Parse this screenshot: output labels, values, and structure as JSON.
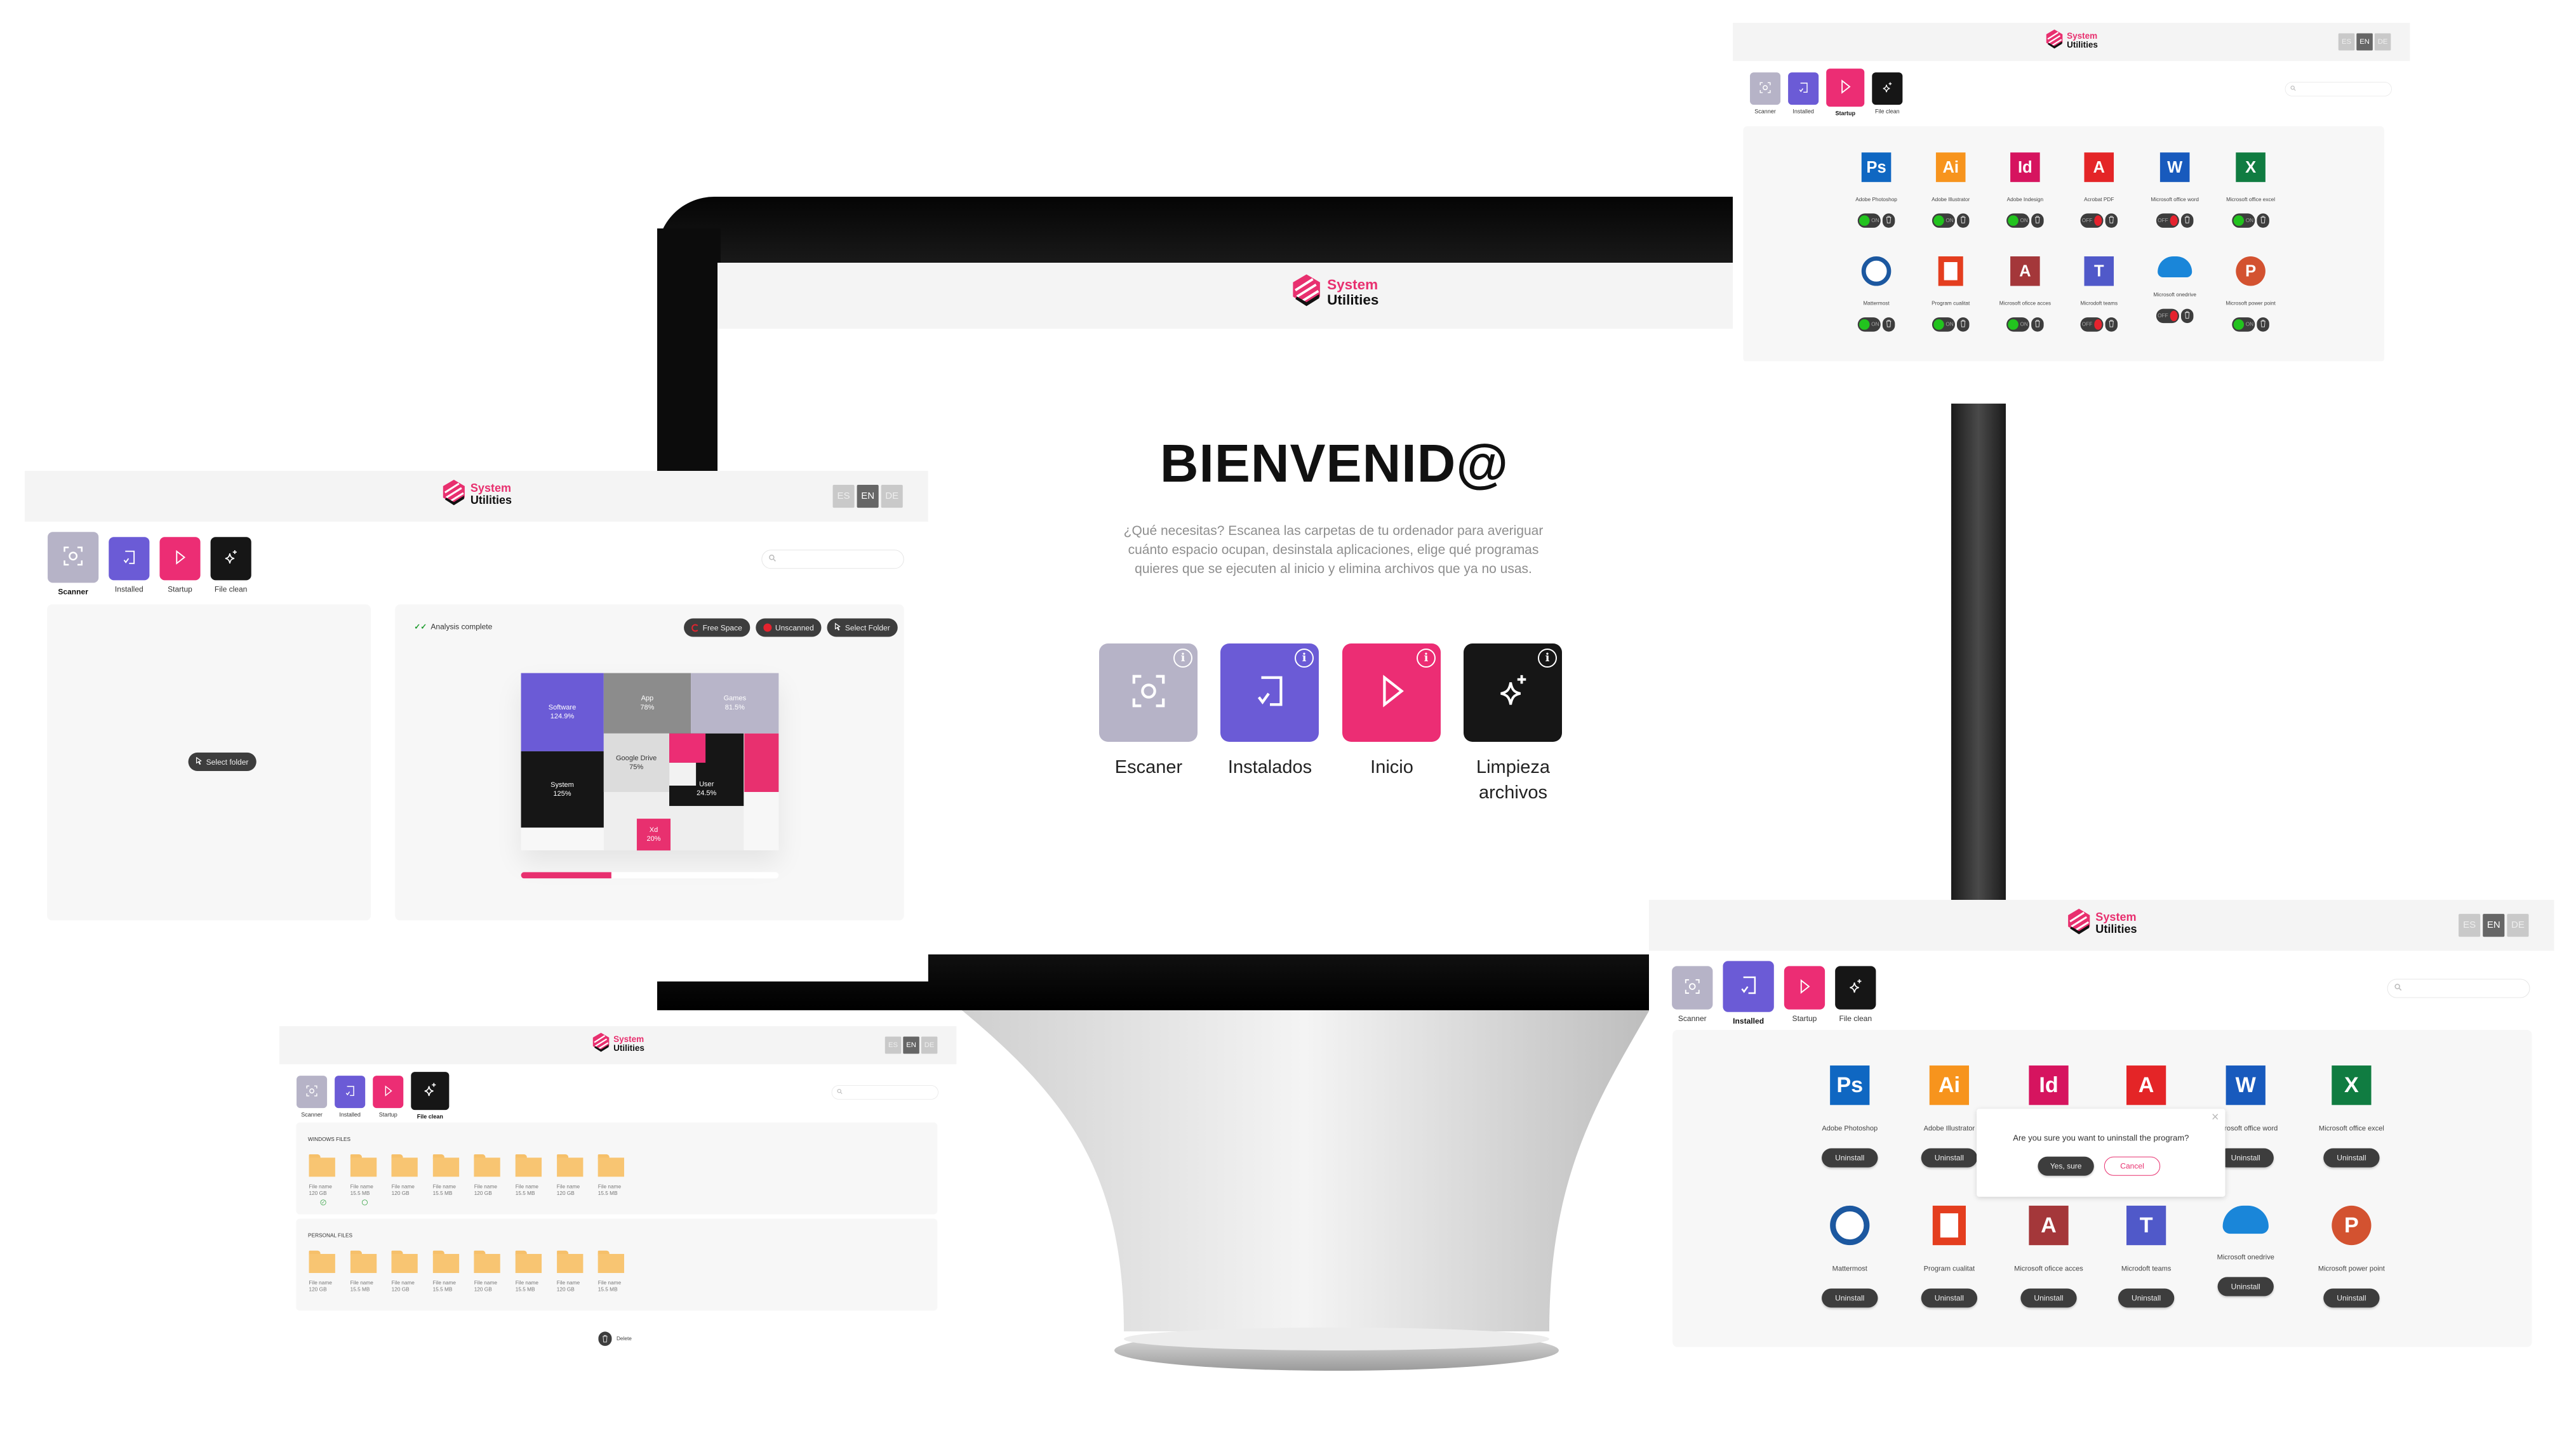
{
  "brand": {
    "line1": "System",
    "line2": "Utilities"
  },
  "languages": [
    "ES",
    "EN",
    "DE"
  ],
  "active_language": "EN",
  "nav": [
    {
      "label": "Scanner",
      "icon": "scan-icon",
      "color": "#b6b3c7"
    },
    {
      "label": "Installed",
      "icon": "installed-icon",
      "color": "#6b5bd6"
    },
    {
      "label": "Startup",
      "icon": "play-icon",
      "color": "#ec2d74"
    },
    {
      "label": "File clean",
      "icon": "sparkle-icon",
      "color": "#161616"
    }
  ],
  "home": {
    "title": "BIENVENID@",
    "description": "¿Qué necesitas? Escanea las carpetas de tu ordenador para averiguar cuánto espacio ocupan, desinstala aplicaciones, elige qué programas quieres que se ejecuten al inicio y elimina archivos que ya no usas.",
    "cards": [
      {
        "label": "Escaner",
        "icon": "scan-icon",
        "color": "#b6b3c7"
      },
      {
        "label": "Instalados",
        "icon": "installed-icon",
        "color": "#6b5bd6"
      },
      {
        "label": "Inicio",
        "icon": "play-icon",
        "color": "#ec2d74"
      },
      {
        "label": "Limpieza archivos",
        "icon": "sparkle-icon",
        "color": "#161616"
      }
    ],
    "info_glyph": "i"
  },
  "scanner": {
    "select_folder": "Select folder",
    "status": "Analysis complete",
    "chips": [
      "Free Space",
      "Unscanned",
      "Select Folder"
    ],
    "treemap": [
      {
        "label": "Software",
        "value": "124.9%",
        "color": "#6b5bd6"
      },
      {
        "label": "App",
        "value": "78%",
        "color": "#8c8c8c"
      },
      {
        "label": "Games",
        "value": "81.5%",
        "color": "#b8b5c9"
      },
      {
        "label": "System",
        "value": "125%",
        "color": "#161616"
      },
      {
        "label": "Google Drive",
        "value": "75%",
        "color": "#dcdcdc"
      },
      {
        "label": "User",
        "value": "24.5%",
        "color": "#161616"
      },
      {
        "label": "Xd",
        "value": "20%",
        "color": "#e8306f"
      }
    ],
    "progress": 0.35
  },
  "apps": [
    {
      "name": "Adobe Photoshop",
      "glyph": "Ps",
      "bg": "#0f67c2",
      "icon": "photoshop-icon"
    },
    {
      "name": "Adobe Illustrator",
      "glyph": "Ai",
      "bg": "#f7941d",
      "icon": "illustrator-icon"
    },
    {
      "name": "Adobe Indesign",
      "glyph": "Id",
      "bg": "#d6145f",
      "icon": "indesign-icon"
    },
    {
      "name": "Acrobat PDF",
      "glyph": "A",
      "bg": "#e42527",
      "icon": "acrobat-icon"
    },
    {
      "name": "Microsoft office word",
      "glyph": "W",
      "bg": "#185abd",
      "icon": "word-icon"
    },
    {
      "name": "Microsoft office excel",
      "glyph": "X",
      "bg": "#107c41",
      "icon": "excel-icon"
    },
    {
      "name": "Mattermost",
      "glyph": "",
      "bg": "#1c58a0",
      "icon": "mattermost-icon"
    },
    {
      "name": "Program cualitat",
      "glyph": "",
      "bg": "#e43e1f",
      "icon": "office-icon"
    },
    {
      "name": "Microsoft oficce acces",
      "glyph": "A",
      "bg": "#a4373a",
      "icon": "access-icon"
    },
    {
      "name": "Microdoft teams",
      "glyph": "T",
      "bg": "#5059c9",
      "icon": "teams-icon"
    },
    {
      "name": "Microsoft onedrive",
      "glyph": "",
      "bg": "#1a86d9",
      "icon": "onedrive-icon"
    },
    {
      "name": "Microsoft power point",
      "glyph": "P",
      "bg": "#d35230",
      "icon": "powerpoint-icon"
    }
  ],
  "startup": {
    "on_label": "ON",
    "off_label": "OFF",
    "states": [
      true,
      true,
      true,
      false,
      false,
      true,
      true,
      true,
      true,
      false,
      false,
      true
    ],
    "on_color": "#22c31e",
    "off_color": "#e5232e"
  },
  "installed": {
    "uninstall_label": "Uninstall",
    "dialog": {
      "message": "Are you sure you want to uninstall the program?",
      "confirm": "Yes, sure",
      "cancel": "Cancel",
      "close": "×"
    }
  },
  "file_clean": {
    "sections": [
      {
        "title": "WINDOWS FILES",
        "files": [
          {
            "name": "File name",
            "size": "120 GB",
            "selected": true
          },
          {
            "name": "File name",
            "size": "15.5 MB",
            "selected": false
          },
          {
            "name": "File name",
            "size": "120 GB"
          },
          {
            "name": "File name",
            "size": "15.5 MB"
          },
          {
            "name": "File name",
            "size": "120 GB"
          },
          {
            "name": "File name",
            "size": "15.5 MB"
          },
          {
            "name": "File name",
            "size": "120 GB"
          },
          {
            "name": "File name",
            "size": "15.5 MB"
          }
        ]
      },
      {
        "title": "PERSONAL FILES",
        "files": [
          {
            "name": "File name",
            "size": "120 GB"
          },
          {
            "name": "File name",
            "size": "15.5 MB"
          },
          {
            "name": "File name",
            "size": "120 GB"
          },
          {
            "name": "File name",
            "size": "15.5 MB"
          },
          {
            "name": "File name",
            "size": "120 GB"
          },
          {
            "name": "File name",
            "size": "15.5 MB"
          },
          {
            "name": "File name",
            "size": "120 GB"
          },
          {
            "name": "File name",
            "size": "15.5 MB"
          }
        ]
      }
    ],
    "delete_label": "Delete"
  }
}
